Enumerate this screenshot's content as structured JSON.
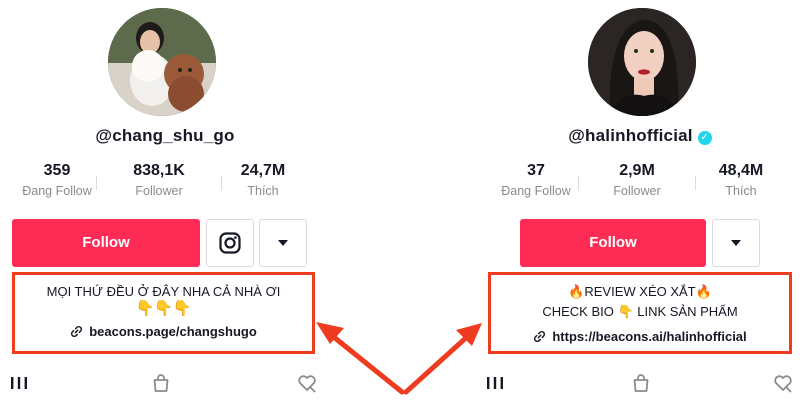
{
  "profiles": [
    {
      "username": "@chang_shu_go",
      "verified": false,
      "stats": [
        {
          "value": "359",
          "label": "Đang Follow"
        },
        {
          "value": "838,1K",
          "label": "Follower"
        },
        {
          "value": "24,7M",
          "label": "Thích"
        }
      ],
      "follow_label": "Follow",
      "secondary_button_icon": "instagram-icon",
      "dropdown_icon": "caret-down-icon",
      "bio_lines": [
        "MỌI THỨ ĐỀU Ở ĐÂY NHA CẢ NHÀ ƠI",
        "👇👇👇"
      ],
      "bio_link": "beacons.page/changshugo",
      "nav_icons": [
        "grid-icon",
        "shopping-bag-icon",
        "liked-icon"
      ]
    },
    {
      "username": "@halinhofficial",
      "verified": true,
      "verified_glyph": "✓",
      "stats": [
        {
          "value": "37",
          "label": "Đang Follow"
        },
        {
          "value": "2,9M",
          "label": "Follower"
        },
        {
          "value": "48,4M",
          "label": "Thích"
        }
      ],
      "follow_label": "Follow",
      "dropdown_icon": "caret-down-icon",
      "bio_lines": [
        "🔥REVIEW XÉO XẮT🔥",
        "CHECK BIO 👇 LINK SẢN PHẨM"
      ],
      "bio_link": "https://beacons.ai/halinhofficial",
      "nav_icons": [
        "grid-icon",
        "shopping-bag-icon",
        "liked-icon"
      ]
    }
  ],
  "colors": {
    "accent": "#fe2c55",
    "highlight": "#ef3b1f",
    "verified": "#20d5ec",
    "muted_text": "#8a8b91"
  }
}
